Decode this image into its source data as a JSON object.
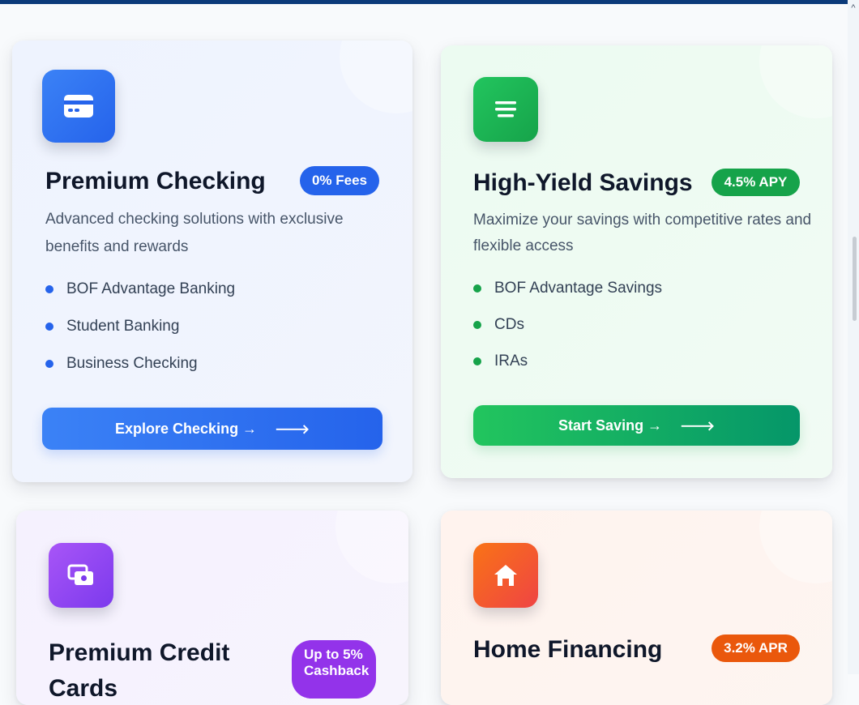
{
  "cards": [
    {
      "icon": "credit-card-icon",
      "title": "Premium Checking",
      "badge": "0% Fees",
      "description": "Advanced checking solutions with exclusive benefits and rewards",
      "features": [
        "BOF Advantage Banking",
        "Student Banking",
        "Business Checking"
      ],
      "button": "Explore Checking →",
      "accent": "#2563eb"
    },
    {
      "icon": "piggy-bank-icon",
      "title": "High-Yield Savings",
      "badge": "4.5% APY",
      "description": "Maximize your savings with competitive rates and flexible access",
      "features": [
        "BOF Advantage Savings",
        "CDs",
        "IRAs"
      ],
      "button": "Start Saving →",
      "accent": "#16a34a"
    },
    {
      "icon": "cards-icon",
      "title": "Premium Credit Cards",
      "badge": "Up to 5% Cashback",
      "accent": "#7c3aed"
    },
    {
      "icon": "home-icon",
      "title": "Home Financing",
      "badge": "3.2% APR",
      "accent": "#ea580c"
    }
  ]
}
